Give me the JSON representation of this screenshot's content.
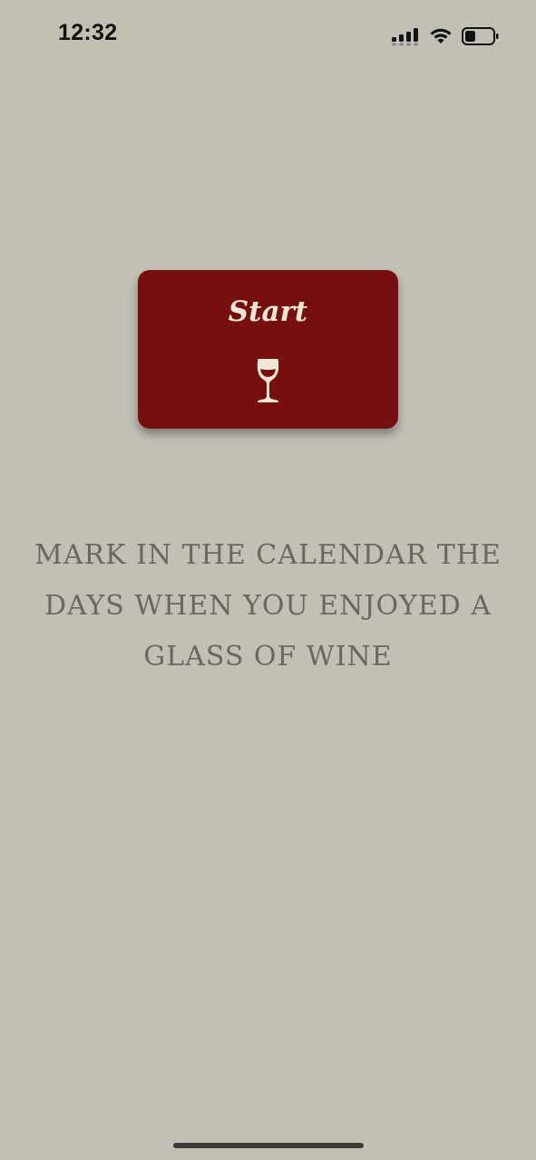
{
  "status_bar": {
    "time": "12:32"
  },
  "start_card": {
    "label": "Start",
    "icon": "wine-glass-icon"
  },
  "instruction": {
    "text": "MARK IN THE CALENDAR THE DAYS WHEN YOU ENJOYED A GLASS OF WINE"
  },
  "colors": {
    "background": "#c2c0b5",
    "card": "#760f10",
    "card_text": "#efe6d6",
    "instruction_text": "#6f655f"
  }
}
